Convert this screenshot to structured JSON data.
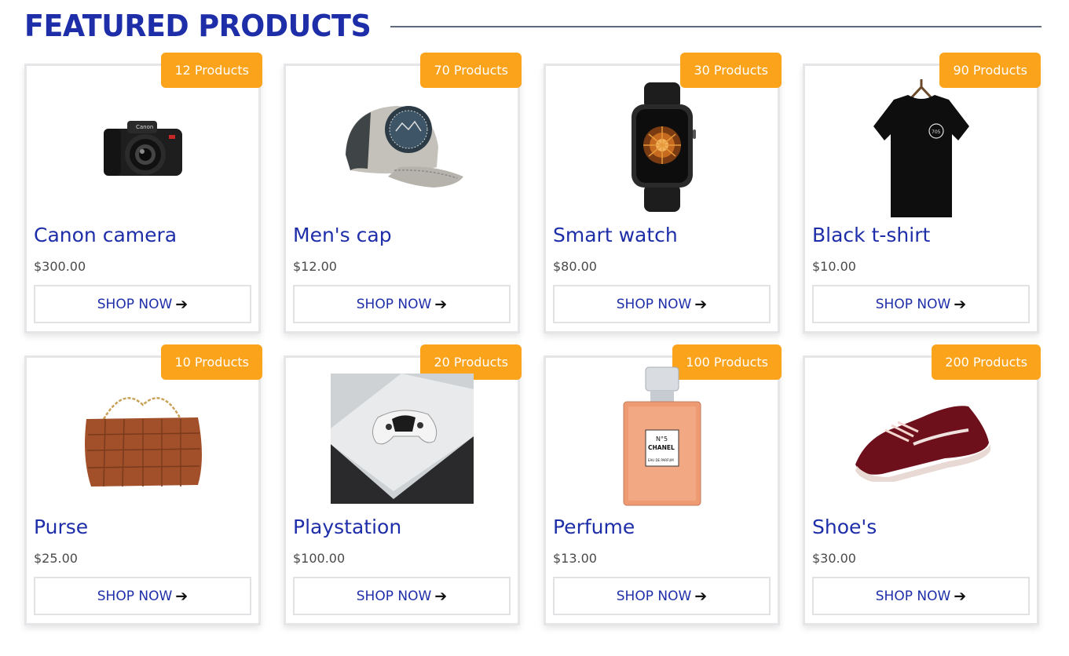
{
  "section": {
    "title": "FEATURED PRODUCTS"
  },
  "shop_label": "SHOP NOW",
  "colors": {
    "accent": "#1e2ea8",
    "badge": "#fca31c"
  },
  "products": [
    {
      "name": "Canon camera",
      "price": "$300.00",
      "badge": "12 Products",
      "icon": "camera-image"
    },
    {
      "name": "Men's cap",
      "price": "$12.00",
      "badge": "70 Products",
      "icon": "cap-image"
    },
    {
      "name": "Smart watch",
      "price": "$80.00",
      "badge": "30 Products",
      "icon": "watch-image"
    },
    {
      "name": "Black t-shirt",
      "price": "$10.00",
      "badge": "90 Products",
      "icon": "tshirt-image"
    },
    {
      "name": "Purse",
      "price": "$25.00",
      "badge": "10 Products",
      "icon": "purse-image"
    },
    {
      "name": "Playstation",
      "price": "$100.00",
      "badge": "20 Products",
      "icon": "playstation-image"
    },
    {
      "name": "Perfume",
      "price": "$13.00",
      "badge": "100 Products",
      "icon": "perfume-image"
    },
    {
      "name": "Shoe's",
      "price": "$30.00",
      "badge": "200 Products",
      "icon": "shoe-image"
    }
  ]
}
